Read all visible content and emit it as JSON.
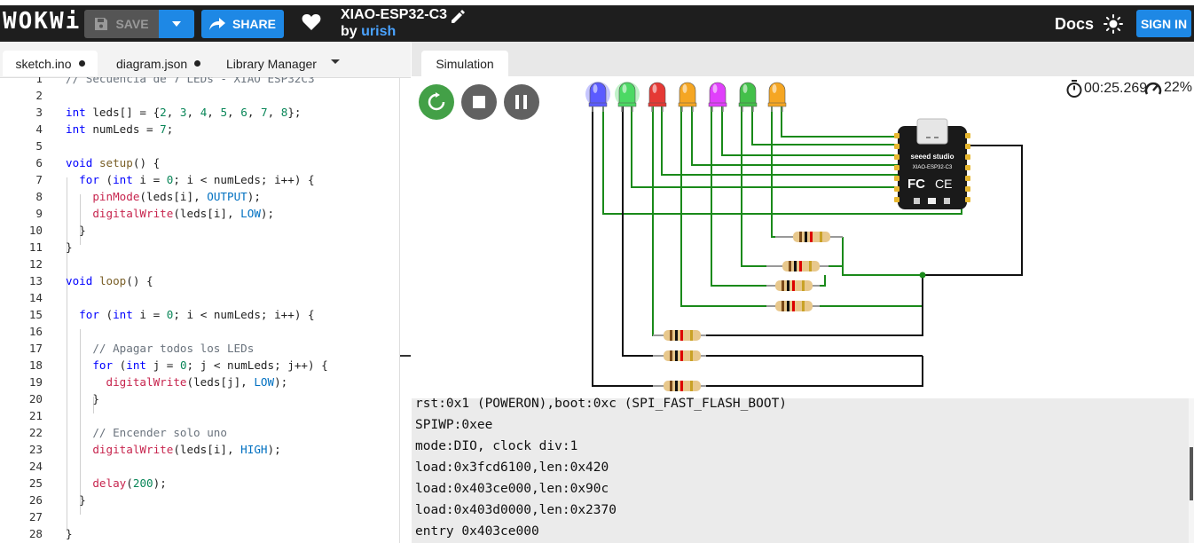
{
  "header": {
    "logo": "WOKWi",
    "save_label": "SAVE",
    "share_label": "SHARE",
    "project_title": "XIAO-ESP32-C3",
    "by_label": "by",
    "author": "urish",
    "docs_label": "Docs",
    "signin_label": "SIGN IN"
  },
  "editor": {
    "tabs": [
      {
        "label": "sketch.ino",
        "modified": true,
        "active": true
      },
      {
        "label": "diagram.json",
        "modified": true,
        "active": false
      },
      {
        "label": "Library Manager",
        "modified": false,
        "active": false
      }
    ],
    "code_lines": [
      {
        "n": "1",
        "text": "// Secuencia de 7 LEDs - XIAO ESP32C3"
      },
      {
        "n": "2",
        "text": ""
      },
      {
        "n": "3",
        "text": "int leds[] = {2, 3, 4, 5, 6, 7, 8};"
      },
      {
        "n": "4",
        "text": "int numLeds = 7;"
      },
      {
        "n": "5",
        "text": ""
      },
      {
        "n": "6",
        "text": "void setup() {"
      },
      {
        "n": "7",
        "text": "  for (int i = 0; i < numLeds; i++) {"
      },
      {
        "n": "8",
        "text": "    pinMode(leds[i], OUTPUT);"
      },
      {
        "n": "9",
        "text": "    digitalWrite(leds[i], LOW);"
      },
      {
        "n": "10",
        "text": "  }"
      },
      {
        "n": "11",
        "text": "}"
      },
      {
        "n": "12",
        "text": ""
      },
      {
        "n": "13",
        "text": "void loop() {"
      },
      {
        "n": "14",
        "text": ""
      },
      {
        "n": "15",
        "text": "  for (int i = 0; i < numLeds; i++) {"
      },
      {
        "n": "16",
        "text": ""
      },
      {
        "n": "17",
        "text": "    // Apagar todos los LEDs"
      },
      {
        "n": "18",
        "text": "    for (int j = 0; j < numLeds; j++) {"
      },
      {
        "n": "19",
        "text": "      digitalWrite(leds[j], LOW);"
      },
      {
        "n": "20",
        "text": "    }"
      },
      {
        "n": "21",
        "text": ""
      },
      {
        "n": "22",
        "text": "    // Encender solo uno"
      },
      {
        "n": "23",
        "text": "    digitalWrite(leds[i], HIGH);"
      },
      {
        "n": "24",
        "text": ""
      },
      {
        "n": "25",
        "text": "    delay(200);"
      },
      {
        "n": "26",
        "text": "  }"
      },
      {
        "n": "27",
        "text": ""
      },
      {
        "n": "28",
        "text": "}"
      }
    ]
  },
  "simulation": {
    "tab_label": "Simulation",
    "timer": "00:25.269",
    "speed": "22%",
    "leds": [
      {
        "color": "#5b5bff",
        "lit": true
      },
      {
        "color": "#4cd964",
        "lit": true
      },
      {
        "color": "#e53935",
        "lit": false
      },
      {
        "color": "#f5a623",
        "lit": false
      },
      {
        "color": "#e040fb",
        "lit": false
      },
      {
        "color": "#43c04a",
        "lit": false
      },
      {
        "color": "#f5a623",
        "lit": false
      }
    ],
    "board": {
      "brand": "seeed studio",
      "model": "XIAO-ESP32-C3"
    },
    "serial_output": [
      "rst:0x1 (POWERON),boot:0xc (SPI_FAST_FLASH_BOOT)",
      "SPIWP:0xee",
      "mode:DIO, clock div:1",
      "load:0x3fcd6100,len:0x420",
      "load:0x403ce000,len:0x90c",
      "load:0x403d0000,len:0x2370",
      "entry 0x403ce000"
    ]
  }
}
